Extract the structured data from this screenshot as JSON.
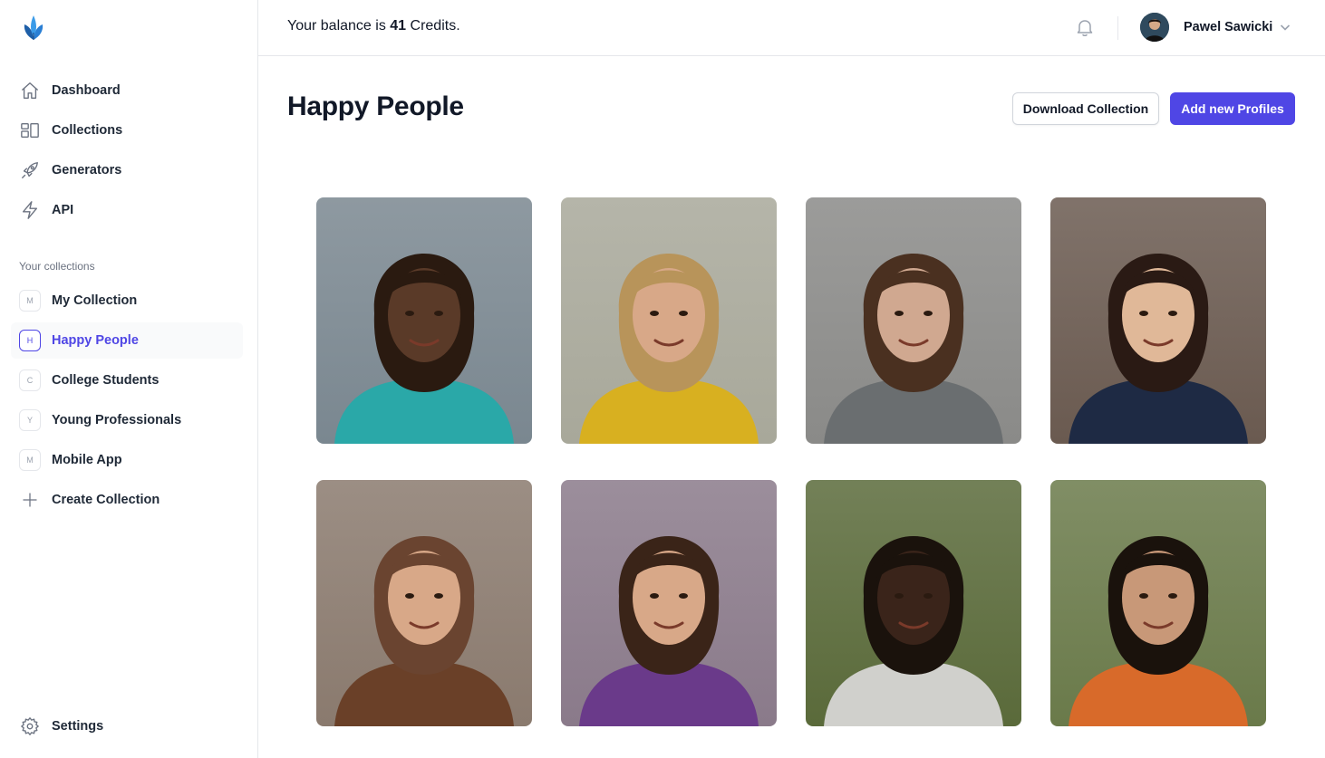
{
  "brand": {
    "logo_icon": "leaf-logo-icon",
    "accent": "#4f46e5"
  },
  "sidebar": {
    "nav": [
      {
        "label": "Dashboard",
        "icon": "home-icon"
      },
      {
        "label": "Collections",
        "icon": "collections-icon"
      },
      {
        "label": "Generators",
        "icon": "rocket-icon"
      },
      {
        "label": "API",
        "icon": "bolt-icon"
      }
    ],
    "collections_label": "Your collections",
    "collections": [
      {
        "initial": "M",
        "label": "My Collection"
      },
      {
        "initial": "H",
        "label": "Happy People",
        "active": true
      },
      {
        "initial": "C",
        "label": "College Students"
      },
      {
        "initial": "Y",
        "label": "Young Professionals"
      },
      {
        "initial": "M",
        "label": "Mobile App"
      }
    ],
    "create_label": "Create Collection",
    "settings_label": "Settings"
  },
  "topbar": {
    "balance_prefix": "Your balance is ",
    "balance_amount": "41",
    "balance_suffix": " Credits.",
    "user_name": "Pawel Sawicki"
  },
  "page": {
    "title": "Happy People",
    "download_label": "Download Collection",
    "add_label": "Add new Profiles"
  },
  "profiles": [
    {
      "name": "profile-photo-1",
      "bg": "#7a8790",
      "skin": "#5a3a28",
      "hair": "#2a1a10",
      "shirt": "#2aa8a8"
    },
    {
      "name": "profile-photo-2",
      "bg": "#a8a89a",
      "skin": "#d8a888",
      "hair": "#b8945a",
      "shirt": "#d8b020"
    },
    {
      "name": "profile-photo-3",
      "bg": "#8a8a88",
      "skin": "#d0a890",
      "hair": "#4a3020",
      "shirt": "#6a6e70"
    },
    {
      "name": "profile-photo-4",
      "bg": "#6a5a50",
      "skin": "#e0b898",
      "hair": "#2a1a14",
      "shirt": "#1e2a44"
    },
    {
      "name": "profile-photo-5",
      "bg": "#8a7a6e",
      "skin": "#d8a888",
      "hair": "#6a4430",
      "shirt": "#6a4028"
    },
    {
      "name": "profile-photo-6",
      "bg": "#8a7a8a",
      "skin": "#d8a888",
      "hair": "#3a2418",
      "shirt": "#6a3a8a"
    },
    {
      "name": "profile-photo-7",
      "bg": "#5a6a3a",
      "skin": "#3a241a",
      "hair": "#1a120c",
      "shirt": "#d0d0cc"
    },
    {
      "name": "profile-photo-8",
      "bg": "#6a7a4a",
      "skin": "#c89878",
      "hair": "#1a120c",
      "shirt": "#d86a2a"
    }
  ]
}
